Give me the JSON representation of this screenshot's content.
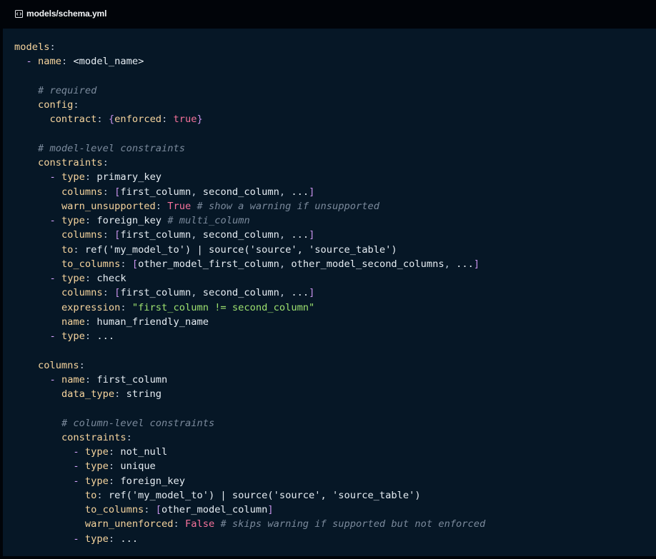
{
  "header": {
    "file_path": "models/schema.yml"
  },
  "code": {
    "lines": [
      [
        {
          "t": "k",
          "x": "models"
        },
        {
          "t": "p",
          "x": ":"
        }
      ],
      [
        {
          "t": "p",
          "x": "  "
        },
        {
          "t": "d",
          "x": "-"
        },
        {
          "t": "p",
          "x": " "
        },
        {
          "t": "k",
          "x": "name"
        },
        {
          "t": "p",
          "x": ": "
        },
        {
          "t": "v",
          "x": "<model_name>"
        }
      ],
      [],
      [
        {
          "t": "p",
          "x": "    "
        },
        {
          "t": "c",
          "x": "# required"
        }
      ],
      [
        {
          "t": "p",
          "x": "    "
        },
        {
          "t": "k",
          "x": "config"
        },
        {
          "t": "p",
          "x": ":"
        }
      ],
      [
        {
          "t": "p",
          "x": "      "
        },
        {
          "t": "k",
          "x": "contract"
        },
        {
          "t": "p",
          "x": ": "
        },
        {
          "t": "br",
          "x": "{"
        },
        {
          "t": "k",
          "x": "enforced"
        },
        {
          "t": "p",
          "x": ": "
        },
        {
          "t": "b",
          "x": "true"
        },
        {
          "t": "br",
          "x": "}"
        }
      ],
      [],
      [
        {
          "t": "p",
          "x": "    "
        },
        {
          "t": "c",
          "x": "# model-level constraints"
        }
      ],
      [
        {
          "t": "p",
          "x": "    "
        },
        {
          "t": "k",
          "x": "constraints"
        },
        {
          "t": "p",
          "x": ":"
        }
      ],
      [
        {
          "t": "p",
          "x": "      "
        },
        {
          "t": "d",
          "x": "-"
        },
        {
          "t": "p",
          "x": " "
        },
        {
          "t": "k",
          "x": "type"
        },
        {
          "t": "p",
          "x": ": "
        },
        {
          "t": "v",
          "x": "primary_key"
        }
      ],
      [
        {
          "t": "p",
          "x": "        "
        },
        {
          "t": "k",
          "x": "columns"
        },
        {
          "t": "p",
          "x": ": "
        },
        {
          "t": "br",
          "x": "["
        },
        {
          "t": "v",
          "x": "first_column"
        },
        {
          "t": "p",
          "x": ", "
        },
        {
          "t": "v",
          "x": "second_column"
        },
        {
          "t": "p",
          "x": ", "
        },
        {
          "t": "v",
          "x": "..."
        },
        {
          "t": "br",
          "x": "]"
        }
      ],
      [
        {
          "t": "p",
          "x": "        "
        },
        {
          "t": "k",
          "x": "warn_unsupported"
        },
        {
          "t": "p",
          "x": ": "
        },
        {
          "t": "b",
          "x": "True"
        },
        {
          "t": "p",
          "x": " "
        },
        {
          "t": "c",
          "x": "# show a warning if unsupported"
        }
      ],
      [
        {
          "t": "p",
          "x": "      "
        },
        {
          "t": "d",
          "x": "-"
        },
        {
          "t": "p",
          "x": " "
        },
        {
          "t": "k",
          "x": "type"
        },
        {
          "t": "p",
          "x": ": "
        },
        {
          "t": "v",
          "x": "foreign_key"
        },
        {
          "t": "p",
          "x": " "
        },
        {
          "t": "c",
          "x": "# multi_column"
        }
      ],
      [
        {
          "t": "p",
          "x": "        "
        },
        {
          "t": "k",
          "x": "columns"
        },
        {
          "t": "p",
          "x": ": "
        },
        {
          "t": "br",
          "x": "["
        },
        {
          "t": "v",
          "x": "first_column"
        },
        {
          "t": "p",
          "x": ", "
        },
        {
          "t": "v",
          "x": "second_column"
        },
        {
          "t": "p",
          "x": ", "
        },
        {
          "t": "v",
          "x": "..."
        },
        {
          "t": "br",
          "x": "]"
        }
      ],
      [
        {
          "t": "p",
          "x": "        "
        },
        {
          "t": "k",
          "x": "to"
        },
        {
          "t": "p",
          "x": ": "
        },
        {
          "t": "v",
          "x": "ref('my_model_to') | source('source', 'source_table')"
        }
      ],
      [
        {
          "t": "p",
          "x": "        "
        },
        {
          "t": "k",
          "x": "to_columns"
        },
        {
          "t": "p",
          "x": ": "
        },
        {
          "t": "br",
          "x": "["
        },
        {
          "t": "v",
          "x": "other_model_first_column"
        },
        {
          "t": "p",
          "x": ", "
        },
        {
          "t": "v",
          "x": "other_model_second_columns"
        },
        {
          "t": "p",
          "x": ", "
        },
        {
          "t": "v",
          "x": "..."
        },
        {
          "t": "br",
          "x": "]"
        }
      ],
      [
        {
          "t": "p",
          "x": "      "
        },
        {
          "t": "d",
          "x": "-"
        },
        {
          "t": "p",
          "x": " "
        },
        {
          "t": "k",
          "x": "type"
        },
        {
          "t": "p",
          "x": ": "
        },
        {
          "t": "v",
          "x": "check"
        }
      ],
      [
        {
          "t": "p",
          "x": "        "
        },
        {
          "t": "k",
          "x": "columns"
        },
        {
          "t": "p",
          "x": ": "
        },
        {
          "t": "br",
          "x": "["
        },
        {
          "t": "v",
          "x": "first_column"
        },
        {
          "t": "p",
          "x": ", "
        },
        {
          "t": "v",
          "x": "second_column"
        },
        {
          "t": "p",
          "x": ", "
        },
        {
          "t": "v",
          "x": "..."
        },
        {
          "t": "br",
          "x": "]"
        }
      ],
      [
        {
          "t": "p",
          "x": "        "
        },
        {
          "t": "k",
          "x": "expression"
        },
        {
          "t": "p",
          "x": ": "
        },
        {
          "t": "s",
          "x": "\"first_column != second_column\""
        }
      ],
      [
        {
          "t": "p",
          "x": "        "
        },
        {
          "t": "k",
          "x": "name"
        },
        {
          "t": "p",
          "x": ": "
        },
        {
          "t": "v",
          "x": "human_friendly_name"
        }
      ],
      [
        {
          "t": "p",
          "x": "      "
        },
        {
          "t": "d",
          "x": "-"
        },
        {
          "t": "p",
          "x": " "
        },
        {
          "t": "k",
          "x": "type"
        },
        {
          "t": "p",
          "x": ": "
        },
        {
          "t": "v",
          "x": "..."
        }
      ],
      [],
      [
        {
          "t": "p",
          "x": "    "
        },
        {
          "t": "k",
          "x": "columns"
        },
        {
          "t": "p",
          "x": ":"
        }
      ],
      [
        {
          "t": "p",
          "x": "      "
        },
        {
          "t": "d",
          "x": "-"
        },
        {
          "t": "p",
          "x": " "
        },
        {
          "t": "k",
          "x": "name"
        },
        {
          "t": "p",
          "x": ": "
        },
        {
          "t": "v",
          "x": "first_column"
        }
      ],
      [
        {
          "t": "p",
          "x": "        "
        },
        {
          "t": "k",
          "x": "data_type"
        },
        {
          "t": "p",
          "x": ": "
        },
        {
          "t": "v",
          "x": "string"
        }
      ],
      [],
      [
        {
          "t": "p",
          "x": "        "
        },
        {
          "t": "c",
          "x": "# column-level constraints"
        }
      ],
      [
        {
          "t": "p",
          "x": "        "
        },
        {
          "t": "k",
          "x": "constraints"
        },
        {
          "t": "p",
          "x": ":"
        }
      ],
      [
        {
          "t": "p",
          "x": "          "
        },
        {
          "t": "d",
          "x": "-"
        },
        {
          "t": "p",
          "x": " "
        },
        {
          "t": "k",
          "x": "type"
        },
        {
          "t": "p",
          "x": ": "
        },
        {
          "t": "v",
          "x": "not_null"
        }
      ],
      [
        {
          "t": "p",
          "x": "          "
        },
        {
          "t": "d",
          "x": "-"
        },
        {
          "t": "p",
          "x": " "
        },
        {
          "t": "k",
          "x": "type"
        },
        {
          "t": "p",
          "x": ": "
        },
        {
          "t": "v",
          "x": "unique"
        }
      ],
      [
        {
          "t": "p",
          "x": "          "
        },
        {
          "t": "d",
          "x": "-"
        },
        {
          "t": "p",
          "x": " "
        },
        {
          "t": "k",
          "x": "type"
        },
        {
          "t": "p",
          "x": ": "
        },
        {
          "t": "v",
          "x": "foreign_key"
        }
      ],
      [
        {
          "t": "p",
          "x": "            "
        },
        {
          "t": "k",
          "x": "to"
        },
        {
          "t": "p",
          "x": ": "
        },
        {
          "t": "v",
          "x": "ref('my_model_to') | source('source', 'source_table')"
        }
      ],
      [
        {
          "t": "p",
          "x": "            "
        },
        {
          "t": "k",
          "x": "to_columns"
        },
        {
          "t": "p",
          "x": ": "
        },
        {
          "t": "br",
          "x": "["
        },
        {
          "t": "v",
          "x": "other_model_column"
        },
        {
          "t": "br",
          "x": "]"
        }
      ],
      [
        {
          "t": "p",
          "x": "            "
        },
        {
          "t": "k",
          "x": "warn_unenforced"
        },
        {
          "t": "p",
          "x": ": "
        },
        {
          "t": "b",
          "x": "False"
        },
        {
          "t": "p",
          "x": " "
        },
        {
          "t": "c",
          "x": "# skips warning if supported but not enforced"
        }
      ],
      [
        {
          "t": "p",
          "x": "          "
        },
        {
          "t": "d",
          "x": "-"
        },
        {
          "t": "p",
          "x": " "
        },
        {
          "t": "k",
          "x": "type"
        },
        {
          "t": "p",
          "x": ": "
        },
        {
          "t": "v",
          "x": "..."
        }
      ]
    ]
  },
  "colors": {
    "page_background": "#010409",
    "code_background": "#061726",
    "key": "#f6d49d",
    "comment": "#7b8a9c",
    "boolean": "#f6729b",
    "string": "#9de16f",
    "bracket": "#c792ea"
  },
  "icons": {
    "file_icon": "code-file-icon"
  }
}
